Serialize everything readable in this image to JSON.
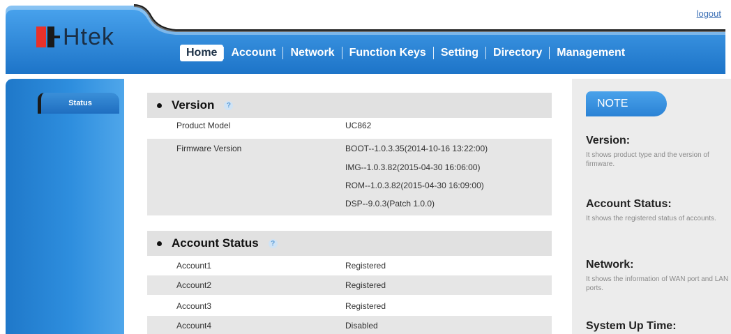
{
  "header": {
    "logout": "logout",
    "nav": [
      "Home",
      "Account",
      "Network",
      "Function Keys",
      "Setting",
      "Directory",
      "Management"
    ],
    "active_nav": "Home"
  },
  "brand": {
    "logo_text": "Htek"
  },
  "colors": {
    "header_blue": "#2b8ce0",
    "sidebar_blue": "#2e8ede",
    "note_blue": "#3a93e2"
  },
  "sidebar": {
    "items": [
      {
        "label": "Status"
      }
    ]
  },
  "sections": {
    "version": {
      "title": "Version",
      "product_model_label": "Product Model",
      "product_model_value": "UC862",
      "firmware_label": "Firmware Version",
      "firmware_values": [
        "BOOT--1.0.3.35(2014-10-16 13:22:00)",
        "IMG--1.0.3.82(2015-04-30 16:06:00)",
        "ROM--1.0.3.82(2015-04-30 16:09:00)",
        "DSP--9.0.3(Patch 1.0.0)"
      ]
    },
    "account_status": {
      "title": "Account Status",
      "rows": [
        {
          "label": "Account1",
          "value": "Registered"
        },
        {
          "label": "Account2",
          "value": "Registered"
        },
        {
          "label": "Account3",
          "value": "Registered"
        },
        {
          "label": "Account4",
          "value": "Disabled"
        }
      ]
    }
  },
  "note": {
    "tab": "NOTE",
    "items": [
      {
        "title": "Version:",
        "desc": "It shows product type and the version of firmware."
      },
      {
        "title": "Account Status:",
        "desc": "It shows the registered status of accounts."
      },
      {
        "title": "Network:",
        "desc": "It shows the information of WAN port and LAN ports."
      },
      {
        "title": "System Up Time:",
        "desc": ""
      }
    ]
  }
}
